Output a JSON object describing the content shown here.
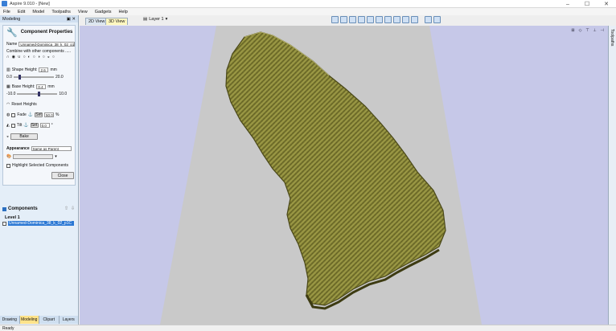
{
  "app": {
    "title": "Aspire 9.010 - [New]"
  },
  "menu": [
    "File",
    "Edit",
    "Model",
    "Toolpaths",
    "View",
    "Gadgets",
    "Help"
  ],
  "view_tabs": {
    "tab2d": "2D View",
    "tab3d": "3D View"
  },
  "layer": {
    "label": "Layer 1"
  },
  "left_panel": {
    "title": "Modeling"
  },
  "component_props": {
    "title": "Component Properties",
    "name_label": "Name",
    "name_value": "Unnamed-Dominica_38_k_02_p1C",
    "combine_label": "Combine with other components .....",
    "shape_height_label": "Shape Height:",
    "shape_height_value": "2.6",
    "shape_height_unit": "mm",
    "shape_min": "0.0",
    "shape_max": "20.0",
    "shape_level": 0.13,
    "base_height_label": "Base Height:",
    "base_height_value": "0.4",
    "base_height_unit": "mm",
    "base_min": "-10.0",
    "base_max": "10.0",
    "base_level": 0.52,
    "reset_heights": "Reset Heights",
    "fade_label": "Fade",
    "fade_set": "Set",
    "fade_value": "50.0",
    "fade_unit": "%",
    "tilt_label": "Tilt",
    "tilt_set": "Set",
    "tilt_value": "0.0",
    "tilt_unit": "°",
    "bake": "Bake",
    "appearance_label": "Appearance",
    "appearance_value": "Same as Parent",
    "highlight_label": "Highlight Selected Components",
    "close": "Close"
  },
  "components": {
    "title": "Components",
    "level": "Level 1",
    "item": "Unnamed-Dominica_38_k_02_p1C"
  },
  "bottom_tabs": [
    "Drawing",
    "Modeling",
    "Clipart",
    "Layers"
  ],
  "right_strip": {
    "label": "Toolpaths"
  },
  "status": {
    "text": "Ready"
  },
  "colors": {
    "terrain": "#8a8838",
    "plane": "#c9c9c9",
    "background": "#c6c8e8",
    "accent": "#3a7fd5"
  }
}
